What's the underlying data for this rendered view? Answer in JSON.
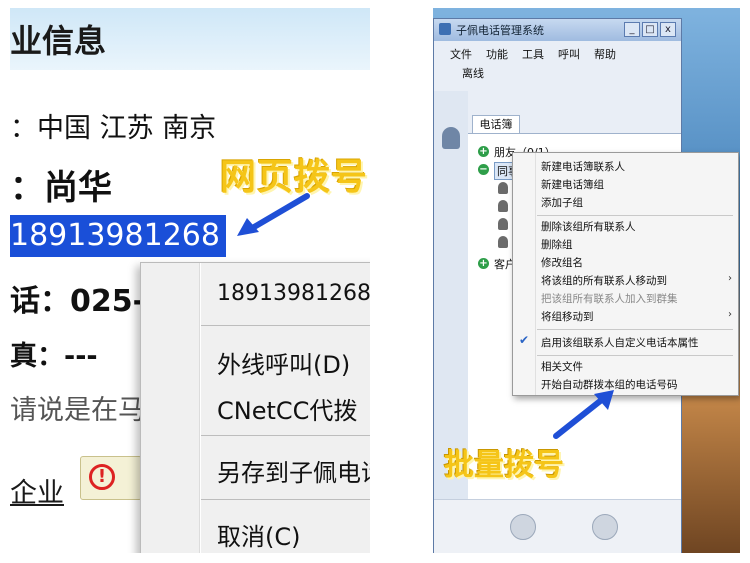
{
  "left": {
    "title": "业信息",
    "address": "：中国 江苏 南京",
    "name": "：尚华",
    "phone_selected": "18913981268",
    "tel": "话：025-",
    "fax": "真：---",
    "ask": "请说是在马",
    "corp_link": "企业",
    "warn_symbol": "!",
    "annotation": "网页拨号",
    "menu": {
      "number": "18913981268",
      "call_out": "外线呼叫(D)",
      "cnetcc": "CNetCC代拨",
      "save_as": "另存到子佩电话",
      "cancel": "取消(C)"
    }
  },
  "right": {
    "window_title": "子佩电话管理系统",
    "caption_buttons": [
      "_",
      "□",
      "x"
    ],
    "menus": [
      "文件",
      "功能",
      "工具",
      "呼叫",
      "帮助"
    ],
    "offline": "离线",
    "tab": "电话簿",
    "tree": {
      "friends": "朋友（0/1）",
      "colleagues": "同事",
      "customers": "客户"
    },
    "context_menu": {
      "new_contact": "新建电话簿联系人",
      "new_group": "新建电话簿组",
      "add_subgroup": "添加子组",
      "delete_all_contacts": "删除该组所有联系人",
      "delete_group": "删除组",
      "rename_group": "修改组名",
      "move_contacts": "将该组的所有联系人移动到",
      "add_to_group_dial": "把该组所有联系人加入到群集",
      "move_group": "将组移动到",
      "enable_custom": "启用该组联系人自定义电话本属性",
      "related_files": "相关文件",
      "auto_group_dial": "开始自动群拨本组的电话号码",
      "submenu_arrow": "›",
      "checkmark": "✔"
    },
    "annotation": "批量拨号"
  },
  "colors": {
    "selection_blue": "#1a4fd8",
    "annotation_yellow": "#f5c518",
    "arrow_blue": "#1f4fd6"
  }
}
